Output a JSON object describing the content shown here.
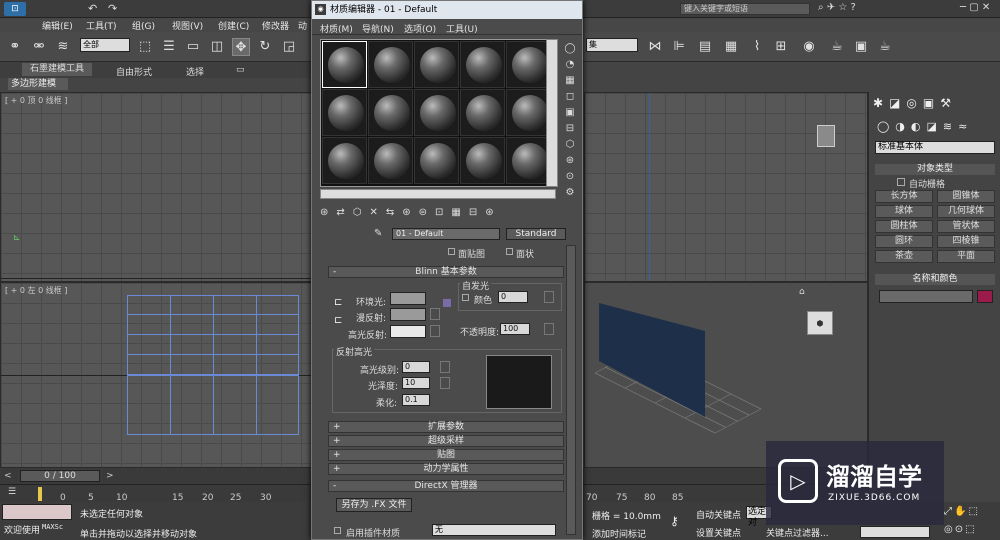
{
  "app": {
    "menu": [
      "编辑(E)",
      "工具(T)",
      "组(G)",
      "视图(V)",
      "创建(C)",
      "修改器",
      "动"
    ],
    "search_placeholder": "键入关键字或短语",
    "toolbar_selection_filter": "全部",
    "ribbon_tabs": [
      "石墨建模工具",
      "自由形式",
      "选择"
    ],
    "ribbon_sub": "多边形建模",
    "viewport_top_label": "[ + 0 顶 0 线框 ]",
    "viewport_left_label": "[ + 0 左 0 线框 ]",
    "named_selection": "集"
  },
  "material_editor": {
    "title": "材质编辑器 - 01 - Default",
    "menu": [
      "材质(M)",
      "导航(N)",
      "选项(O)",
      "工具(U)"
    ],
    "material_name": "01 - Default",
    "material_type": "Standard",
    "face_map": "面贴图",
    "faceted": "面状",
    "blinn_rollout": "Blinn 基本参数",
    "self_illum": "自发光",
    "color_label": "颜色",
    "self_illum_value": "0",
    "ambient": "环境光:",
    "diffuse": "漫反射:",
    "specular": "高光反射:",
    "opacity_label": "不透明度:",
    "opacity": "100",
    "spec_highlights": "反射高光",
    "spec_level_label": "高光级别:",
    "spec_level": "0",
    "gloss_label": "光泽度:",
    "gloss": "10",
    "soften_label": "柔化:",
    "soften": "0.1",
    "rollouts": [
      "扩展参数",
      "超级采样",
      "贴图",
      "动力学属性"
    ],
    "directx": "DirectX 管理器",
    "save_fx": "另存为 .FX 文件",
    "enable_plugin": "启用插件材质",
    "plugin_value": "无"
  },
  "command_panel": {
    "dropdown": "标准基本体",
    "object_type": "对象类型",
    "autogrid": "自动栅格",
    "buttons": [
      "长方体",
      "圆锥体",
      "球体",
      "几何球体",
      "圆柱体",
      "管状体",
      "圆环",
      "四棱锥",
      "茶壶",
      "平面"
    ],
    "name_color": "名称和颜色"
  },
  "timeline": {
    "frame": "0 / 100",
    "ticks": [
      "0",
      "5",
      "10",
      "15",
      "20",
      "25",
      "30",
      "70",
      "75",
      "80",
      "85"
    ]
  },
  "status": {
    "welcome": "欢迎使用",
    "maxscript": "MAXSc",
    "no_selection": "未选定任何对象",
    "hint": "单击并拖动以选择并移动对象",
    "grid": "栅格 = 10.0mm",
    "add_time_tag": "添加时间标记",
    "auto_key": "自动关键点",
    "set_key": "设置关键点",
    "selected": "选定对",
    "key_filters": "关键点过滤器..."
  },
  "watermark": {
    "brand": "溜溜自学",
    "url": "ZIXUE.3D66.COM"
  },
  "colors": {
    "ambient": "#9a9a9a",
    "diffuse": "#9a9a9a",
    "specular": "#e8e8e8",
    "name_color": "#9b1b4a",
    "wall": "#1e2f4a",
    "highlight_curve": "#1a1a1a"
  }
}
